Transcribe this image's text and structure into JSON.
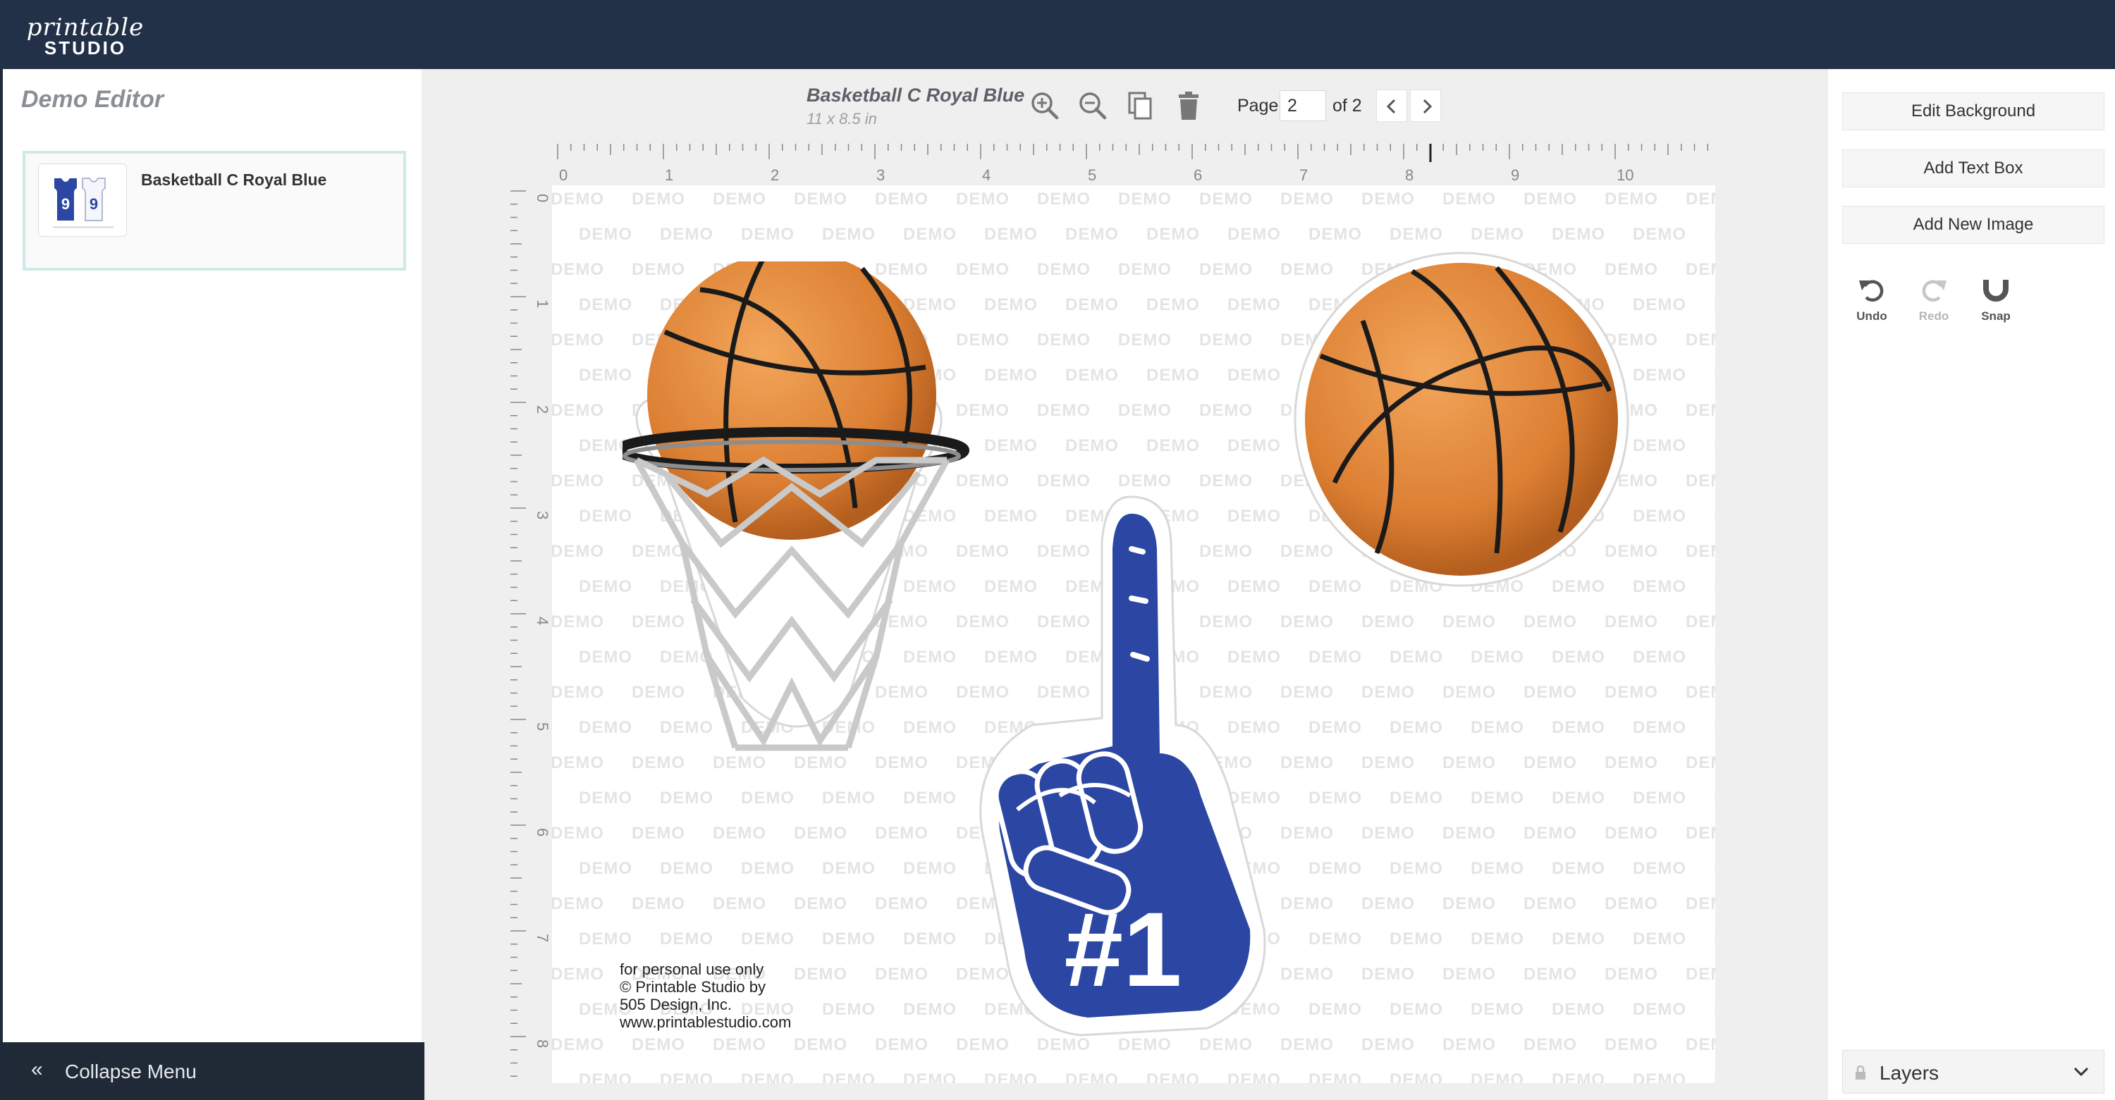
{
  "brand": {
    "logo_line1": "printable",
    "logo_line2": "STUDIO"
  },
  "sidebar": {
    "title": "Demo Editor",
    "projects": [
      {
        "name": "Basketball C Royal Blue",
        "thumb_numbers": [
          "9",
          "9"
        ]
      }
    ],
    "collapse_label": "Collapse Menu"
  },
  "toolbar": {
    "doc_title": "Basketball C Royal Blue",
    "doc_size": "11 x 8.5 in",
    "tools": [
      "zoom-in-icon",
      "zoom-out-icon",
      "copy-icon",
      "trash-icon"
    ],
    "page_label": "Page",
    "page_value": "2",
    "page_of": "of 2"
  },
  "ruler": {
    "horizontal_labels": [
      "0",
      "1",
      "2",
      "3",
      "4",
      "5",
      "6",
      "7",
      "8",
      "9",
      "10"
    ],
    "vertical_labels": [
      "0",
      "1",
      "2",
      "3",
      "4",
      "5",
      "6",
      "7",
      "8"
    ]
  },
  "canvas": {
    "watermark": "DEMO",
    "jersey_number": "9",
    "foam_finger_text": "#1",
    "credit_lines": [
      "for personal use only",
      "© Printable Studio by",
      "505 Design, Inc.",
      "www.printablestudio.com"
    ],
    "colors": {
      "royal_blue": "#2b47a3",
      "ball_orange": "#e08a3c",
      "net_gray": "#c8c8c8"
    }
  },
  "right_panel": {
    "buttons": [
      "Edit Background",
      "Add Text Box",
      "Add New Image"
    ],
    "history": [
      {
        "label": "Undo",
        "icon": "undo-icon",
        "enabled": true
      },
      {
        "label": "Redo",
        "icon": "redo-icon",
        "enabled": false
      },
      {
        "label": "Snap",
        "icon": "magnet-icon",
        "enabled": true
      }
    ],
    "layers_label": "Layers"
  }
}
